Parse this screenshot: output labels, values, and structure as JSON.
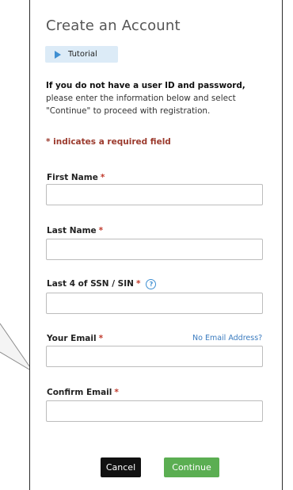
{
  "form": {
    "title": "Create an Account",
    "tutorial_label": "Tutorial",
    "intro_bold": "If you do not have a user ID and password,",
    "intro_rest": " please enter the information below and select \"Continue\" to proceed with registration.",
    "required_note": "* indicates a required field",
    "required_marker": "*",
    "fields": {
      "first_name": {
        "label": "First Name",
        "value": ""
      },
      "last_name": {
        "label": "Last Name",
        "value": ""
      },
      "ssn_last4": {
        "label": "Last 4 of SSN / SIN",
        "value": ""
      },
      "email": {
        "label": "Your Email",
        "value": ""
      },
      "confirm_email": {
        "label": "Confirm Email",
        "value": ""
      }
    },
    "help_glyph": "?",
    "no_email_link": "No Email Address?",
    "cancel_label": "Cancel",
    "continue_label": "Continue"
  },
  "colors": {
    "accent_blue": "#3f8fd2",
    "required_red": "#9b3a2d",
    "continue_green": "#5bae52",
    "cancel_black": "#111111",
    "tutorial_bg": "#dcebf7"
  },
  "icons": {
    "tutorial": "play-triangle-icon",
    "help": "help-circle-icon"
  }
}
